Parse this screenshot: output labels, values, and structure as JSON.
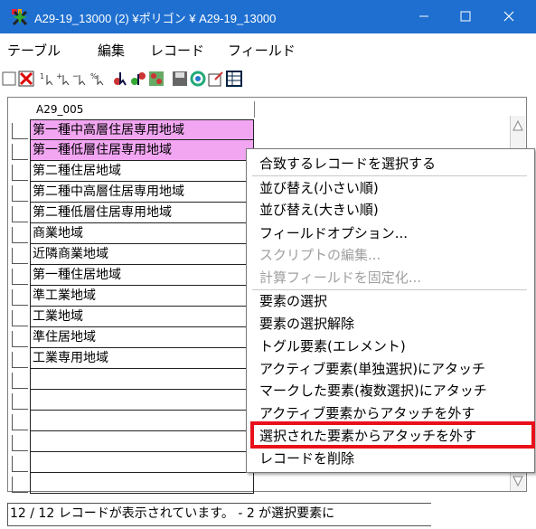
{
  "window": {
    "title": "A29-19_13000 (2) ¥ポリゴン ¥ A29-19_13000",
    "title_bar_color": "#1e6fd0",
    "controls": [
      "minimize-icon",
      "maximize-icon",
      "close-icon"
    ]
  },
  "menubar": {
    "items": [
      "テーブル",
      "編集",
      "レコード",
      "フィールド"
    ]
  },
  "toolbar": {
    "icons": [
      "checkbox-icon",
      "delete-record-icon",
      "cursor-1-icon",
      "cursor-plus-icon",
      "cursor-minus-icon",
      "cursor-percent-icon",
      "select-tool-icon",
      "select-add-icon",
      "select-grid-icon",
      "save-icon",
      "refresh-icon",
      "edit-icon",
      "table-icon"
    ]
  },
  "grid": {
    "column_header": "A29_005",
    "selection_color": "#f2a6f2",
    "rows": [
      {
        "value": "第一種中高層住居専用地域",
        "selected": true
      },
      {
        "value": "第一種低層住居専用地域",
        "selected": true
      },
      {
        "value": "第二種住居地域",
        "selected": false
      },
      {
        "value": "第二種中高層住居専用地域",
        "selected": false
      },
      {
        "value": "第二種低層住居専用地域",
        "selected": false
      },
      {
        "value": "商業地域",
        "selected": false
      },
      {
        "value": "近隣商業地域",
        "selected": false
      },
      {
        "value": "第一種住居地域",
        "selected": false
      },
      {
        "value": "準工業地域",
        "selected": false
      },
      {
        "value": "工業地域",
        "selected": false
      },
      {
        "value": "準住居地域",
        "selected": false
      },
      {
        "value": "工業専用地域",
        "selected": false
      },
      {
        "value": "",
        "selected": false
      },
      {
        "value": "",
        "selected": false
      },
      {
        "value": "",
        "selected": false
      },
      {
        "value": "",
        "selected": false
      },
      {
        "value": "",
        "selected": false
      },
      {
        "value": "",
        "selected": false
      }
    ]
  },
  "context_menu": {
    "items": [
      {
        "label": "合致するレコードを選択する",
        "disabled": false
      },
      {
        "label": "並び替え(小さい順)",
        "disabled": false
      },
      {
        "label": "並び替え(大きい順)",
        "disabled": false
      },
      {
        "label": "フィールドオプション...",
        "disabled": false
      },
      {
        "label": "スクリプトの編集...",
        "disabled": true
      },
      {
        "label": "計算フィールドを固定化...",
        "disabled": true
      },
      {
        "label": "要素の選択",
        "disabled": false
      },
      {
        "label": "要素の選択解除",
        "disabled": false
      },
      {
        "label": "トグル要素(エレメント)",
        "disabled": false
      },
      {
        "label": "アクティブ要素(単独選択)にアタッチ",
        "disabled": false
      },
      {
        "label": "マークした要素(複数選択)にアタッチ",
        "disabled": false
      },
      {
        "label": "アクティブ要素からアタッチを外す",
        "disabled": false
      },
      {
        "label": "選択された要素からアタッチを外す",
        "disabled": false,
        "highlighted": true
      },
      {
        "label": "レコードを削除",
        "disabled": false
      }
    ],
    "highlight_color": "#e8101a"
  },
  "status": {
    "text": "12 / 12 レコードが表示されています。 - 2 が選択要素に"
  }
}
